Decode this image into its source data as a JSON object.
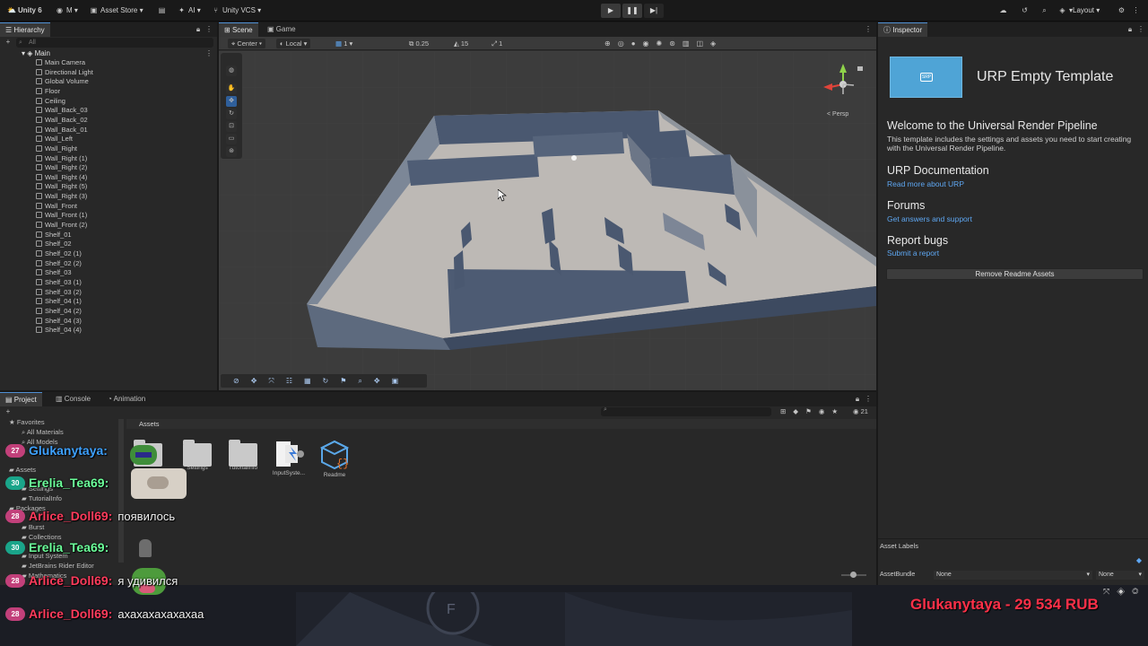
{
  "topbar": {
    "account": "Unity 6",
    "user_initial": "M",
    "asset_store": "Asset Store",
    "ai": "AI",
    "vcs": "Unity VCS",
    "layout": "Layout"
  },
  "hierarchy": {
    "tab": "Hierarchy",
    "search_placeholder": "All",
    "scene": "Main",
    "items": [
      "Main Camera",
      "Directional Light",
      "Global Volume",
      "Floor",
      "Ceiling",
      "Wall_Back_03",
      "Wall_Back_02",
      "Wall_Back_01",
      "Wall_Left",
      "Wall_Right",
      "Wall_Right (1)",
      "Wall_Right (2)",
      "Wall_Right (4)",
      "Wall_Right (5)",
      "Wall_Right (3)",
      "Wall_Front",
      "Wall_Front (1)",
      "Wall_Front (2)",
      "Shelf_01",
      "Shelf_02",
      "Shelf_02 (1)",
      "Shelf_02 (2)",
      "Shelf_03",
      "Shelf_03 (1)",
      "Shelf_03 (2)",
      "Shelf_04 (1)",
      "Shelf_04 (2)",
      "Shelf_04 (3)",
      "Shelf_04 (4)"
    ]
  },
  "scene": {
    "tab_scene": "Scene",
    "tab_game": "Game",
    "pivot": "Center",
    "space": "Local",
    "grid_count": "1",
    "snap_value": "0.25",
    "rotate_snap": "15",
    "scale_snap": "1",
    "view_mode": "< Persp"
  },
  "inspector": {
    "tab": "Inspector",
    "title": "URP Empty Template",
    "logo_text": "SRP",
    "welcome_heading": "Welcome to the Universal Render Pipeline",
    "welcome_text": "This template includes the settings and assets you need to start creating with the Universal Render Pipeline.",
    "doc_heading": "URP Documentation",
    "doc_link": "Read more about URP",
    "forums_heading": "Forums",
    "forums_link": "Get answers and support",
    "bugs_heading": "Report bugs",
    "bugs_link": "Submit a report",
    "remove_button": "Remove Readme Assets",
    "asset_labels": "Asset Labels",
    "asset_bundle": "AssetBundle",
    "bundle_value": "None",
    "variant_value": "None"
  },
  "project": {
    "tab_project": "Project",
    "tab_console": "Console",
    "tab_animation": "Animation",
    "breadcrumb": "Assets",
    "count": "21",
    "tree": [
      "Favorites",
      "All Materials",
      "All Models",
      "Assets",
      "Settings",
      "TutorialInfo",
      "Packages",
      "Burst",
      "Collections",
      "Input System",
      "JetBrains Rider Editor",
      "Mathematics"
    ],
    "assets": [
      "Settings",
      "TutorialInfo",
      "InputSyste...",
      "Readme"
    ]
  },
  "chat": [
    {
      "badge": "27",
      "badge_color": "#c2407a",
      "user": "Glukanytaya:",
      "user_color": "#3ea1ff",
      "message": ""
    },
    {
      "badge": "30",
      "badge_color": "#1aa58a",
      "user": "Erelia_Tea69:",
      "user_color": "#6bff9a",
      "message": ""
    },
    {
      "badge": "28",
      "badge_color": "#c2407a",
      "user": "Arlice_Doll69:",
      "user_color": "#ff3b5c",
      "message": "появилось"
    },
    {
      "badge": "30",
      "badge_color": "#1aa58a",
      "user": "Erelia_Tea69:",
      "user_color": "#6bff9a",
      "message": ""
    },
    {
      "badge": "28",
      "badge_color": "#c2407a",
      "user": "Arlice_Doll69:",
      "user_color": "#ff3b5c",
      "message": "я удивился"
    },
    {
      "badge": "28",
      "badge_color": "#c2407a",
      "user": "Arlice_Doll69:",
      "user_color": "#ff3b5c",
      "message": "ахахахахахахаа"
    }
  ],
  "donation": "Glukanytaya - 29 534 RUB"
}
